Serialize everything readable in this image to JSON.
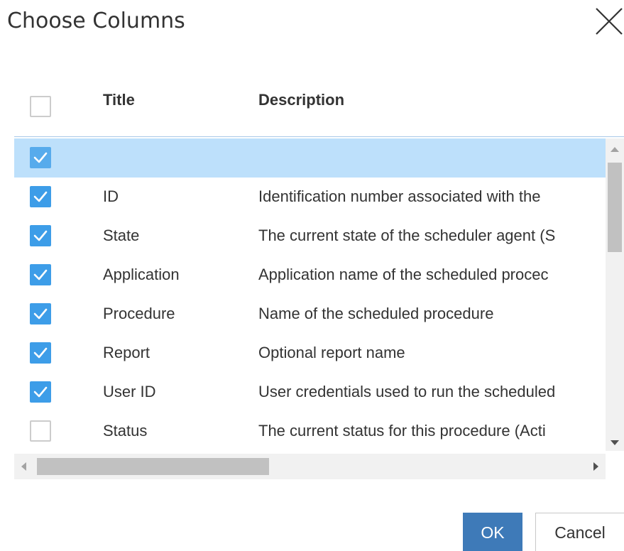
{
  "dialog": {
    "title": "Choose Columns",
    "ok_label": "OK",
    "cancel_label": "Cancel",
    "close_icon": "close-icon"
  },
  "columns": {
    "title": "Title",
    "description": "Description",
    "select_all_checked": false
  },
  "rows": [
    {
      "title": "",
      "description": "",
      "checked": true,
      "selected": true
    },
    {
      "title": "ID",
      "description": "Identification number associated with the",
      "checked": true,
      "selected": false
    },
    {
      "title": "State",
      "description": "The current state of the scheduler agent (S",
      "checked": true,
      "selected": false
    },
    {
      "title": "Application",
      "description": "Application name of the scheduled procec",
      "checked": true,
      "selected": false
    },
    {
      "title": "Procedure",
      "description": "Name of the scheduled procedure",
      "checked": true,
      "selected": false
    },
    {
      "title": "Report",
      "description": "Optional report name",
      "checked": true,
      "selected": false
    },
    {
      "title": "User ID",
      "description": "User credentials used to run the scheduled",
      "checked": true,
      "selected": false
    },
    {
      "title": "Status",
      "description": "The current status for this procedure (Acti",
      "checked": false,
      "selected": false
    }
  ],
  "colors": {
    "accent": "#3d9de8",
    "selected_row": "#bde0fb",
    "ok_button": "#3e7ab8"
  }
}
